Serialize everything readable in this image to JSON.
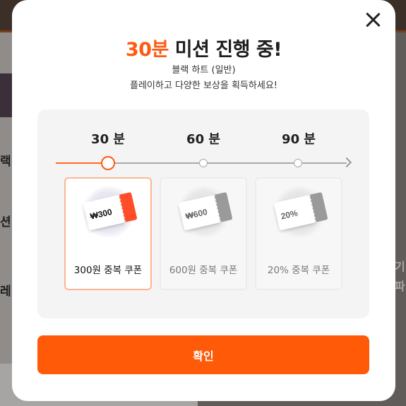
{
  "backdrop": {
    "left_glyphs": [
      "랙",
      "션",
      "레"
    ],
    "right_glyphs": [
      "기",
      "파"
    ]
  },
  "modal": {
    "title_accent": "30분",
    "title_rest": " 미션 진행 중!",
    "subtitle": "블랙 하트 (일반)",
    "description": "플레이하고 다양한 보상을 획득하세요!",
    "confirm_label": "확인"
  },
  "progress": {
    "current_stage_index": 0,
    "stages": [
      {
        "label": "30 분",
        "reward": "300원 중복 쿠폰",
        "coupon_amount": "₩300",
        "active": true
      },
      {
        "label": "60 분",
        "reward": "600원 중복 쿠폰",
        "coupon_amount": "₩600",
        "active": false
      },
      {
        "label": "90 분",
        "reward": "20% 중복 쿠폰",
        "coupon_amount": "20%",
        "active": false
      }
    ]
  },
  "colors": {
    "accent": "#ff5a13",
    "button": "#ff5a08",
    "active_border": "#ffb594"
  }
}
